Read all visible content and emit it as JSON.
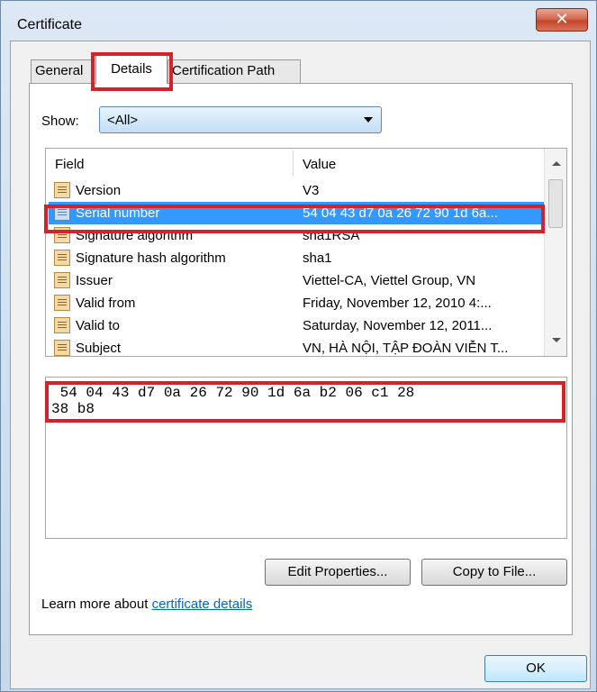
{
  "window": {
    "title": "Certificate",
    "close_glyph": "✕"
  },
  "tabs": [
    {
      "label": "General"
    },
    {
      "label": "Details",
      "selected": true
    },
    {
      "label": "Certification Path"
    }
  ],
  "show": {
    "label": "Show:",
    "value": "<All>"
  },
  "list": {
    "columns": {
      "field": "Field",
      "value": "Value"
    },
    "rows": [
      {
        "field": "Version",
        "value": "V3"
      },
      {
        "field": "Serial number",
        "value": "54 04 43 d7 0a 26 72 90 1d 6a...",
        "selected": true
      },
      {
        "field": "Signature algorithm",
        "value": "sha1RSA"
      },
      {
        "field": "Signature hash algorithm",
        "value": "sha1"
      },
      {
        "field": "Issuer",
        "value": "Viettel-CA, Viettel Group, VN"
      },
      {
        "field": "Valid from",
        "value": "Friday, November 12, 2010 4:..."
      },
      {
        "field": "Valid to",
        "value": "Saturday, November 12, 2011..."
      },
      {
        "field": "Subject",
        "value": "VN, HÀ NỘI, TẬP ĐOÀN VIỄN T..."
      }
    ]
  },
  "detail": {
    "text": " 54 04 43 d7 0a 26 72 90 1d 6a b2 06 c1 28\n38 b8"
  },
  "buttons": {
    "edit_properties": "Edit Properties...",
    "copy_to_file": "Copy to File...",
    "ok": "OK"
  },
  "learn_more": {
    "prefix": "Learn more about ",
    "link": "certificate details"
  },
  "colors": {
    "highlight_box": "#d2232a",
    "selection": "#3399ff",
    "link": "#0066cc"
  },
  "icons": {
    "row_icon": "certificate-field-icon",
    "dropdown": "chevron-down-icon",
    "close": "close-icon"
  }
}
